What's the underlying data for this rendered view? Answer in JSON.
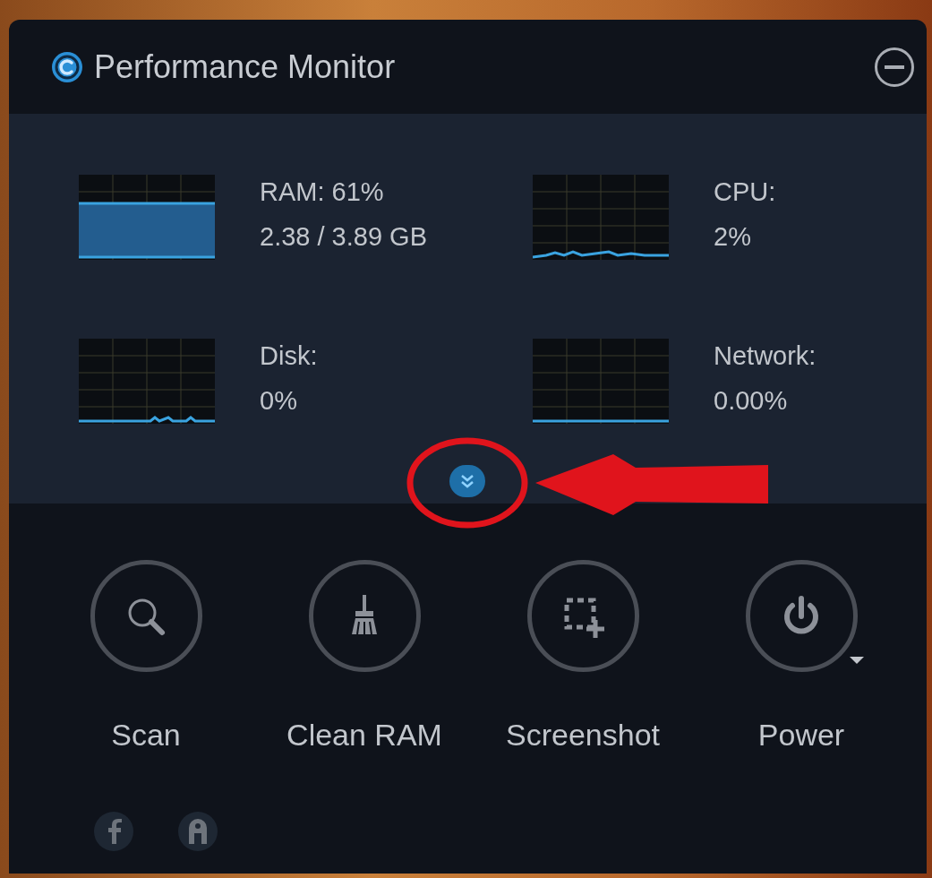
{
  "window": {
    "title": "Performance Monitor"
  },
  "meters": [
    {
      "kind": "bar",
      "label": "RAM: 61%",
      "detail": "2.38 / 3.89 GB"
    },
    {
      "kind": "history",
      "label": "CPU:",
      "detail": "2%"
    },
    {
      "kind": "history",
      "label": "Disk:",
      "detail": "0%"
    },
    {
      "kind": "history",
      "label": "Network:",
      "detail": "0.00%"
    }
  ],
  "actions": [
    {
      "kind": "scan",
      "label": "Scan"
    },
    {
      "kind": "clean",
      "label": "Clean RAM"
    },
    {
      "kind": "screenshot",
      "label": "Screenshot"
    },
    {
      "kind": "power",
      "label": "Power"
    }
  ],
  "footer_links": [
    {
      "kind": "facebook"
    },
    {
      "kind": "info"
    }
  ]
}
